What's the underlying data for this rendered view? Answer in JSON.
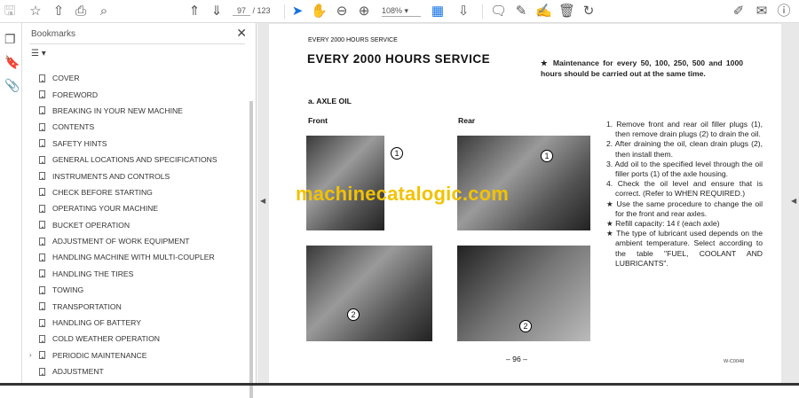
{
  "toolbar": {
    "page_current": "97",
    "page_total": "/ 123",
    "zoom": "108%"
  },
  "bookmarks": {
    "title": "Bookmarks",
    "items": [
      "COVER",
      "FOREWORD",
      "BREAKING IN YOUR NEW MACHINE",
      "CONTENTS",
      "SAFETY HINTS",
      "GENERAL LOCATIONS AND SPECIFICATIONS",
      "INSTRUMENTS AND CONTROLS",
      "CHECK BEFORE STARTING",
      "OPERATING YOUR MACHINE",
      "BUCKET OPERATION",
      "ADJUSTMENT OF WORK EQUIPMENT",
      "HANDLING MACHINE WITH MULTI-COUPLER",
      "HANDLING THE TIRES",
      "TOWING",
      "TRANSPORTATION",
      "HANDLING OF BATTERY",
      "COLD WEATHER OPERATION",
      "PERIODIC MAINTENANCE",
      "ADJUSTMENT"
    ]
  },
  "doc": {
    "running_head": "EVERY 2000 HOURS SERVICE",
    "title": "EVERY 2000 HOURS SERVICE",
    "note": "★ Maintenance for every 50, 100, 250, 500 and 1000 hours should be carried out at the same time.",
    "section": "a.  AXLE OIL",
    "front": "Front",
    "rear": "Rear",
    "steps": [
      "1. Remove front and rear oil filler plugs (1), then remove drain plugs (2) to drain the oil.",
      "2. After draining the oil, clean drain plugs (2), then install them.",
      "3. Add oil to the specified level through the oil filler ports (1) of the axle housing.",
      "4. Check the oil level and ensure that is correct. (Refer to WHEN REQUIRED.)",
      "★ Use the same procedure to change the oil for the front and rear axles.",
      "★ Refill capacity:  14 ℓ (each axle)",
      "★ The type of lubricant used depends on the ambient temperature. Select according to the table \"FUEL, COOLANT AND LUBRICANTS\"."
    ],
    "page_number": "– 96 –",
    "code": "W-C0048",
    "watermark": "machinecatalogic.com",
    "callouts": [
      "1",
      "1",
      "2",
      "2"
    ]
  }
}
